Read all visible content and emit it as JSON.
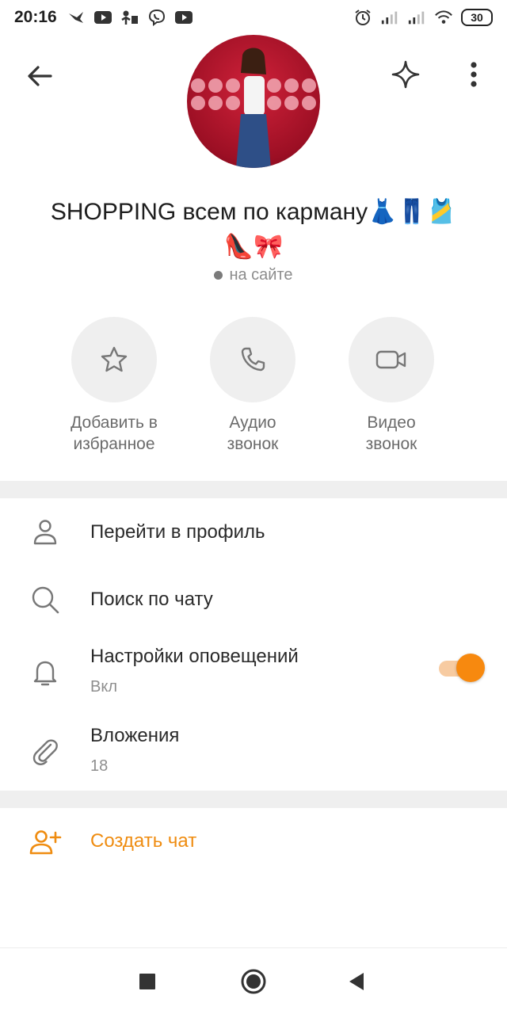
{
  "status_bar": {
    "time": "20:16",
    "battery": "30"
  },
  "header": {
    "back_icon": "arrow-left-icon",
    "sparkle_icon": "sparkle-icon",
    "more_icon": "more-vertical-icon"
  },
  "chat": {
    "title_line1": "SHOPPING всем по карману👗👖🎽",
    "title_line2": "👠🎀",
    "presence": "на сайте"
  },
  "actions": [
    {
      "icon": "star-icon",
      "line1": "Добавить в",
      "line2": "избранное"
    },
    {
      "icon": "phone-icon",
      "line1": "Аудио",
      "line2": "звонок"
    },
    {
      "icon": "video-icon",
      "line1": "Видео",
      "line2": "звонок"
    }
  ],
  "menu": {
    "profile": {
      "label": "Перейти в профиль",
      "icon": "person-icon"
    },
    "search": {
      "label": "Поиск по чату",
      "icon": "search-icon"
    },
    "notifications": {
      "label": "Настройки оповещений",
      "value": "Вкл",
      "icon": "bell-icon",
      "enabled": true
    },
    "attachments": {
      "label": "Вложения",
      "value": "18",
      "icon": "paperclip-icon"
    },
    "create_chat": {
      "label": "Создать чат",
      "icon": "add-person-icon"
    }
  },
  "colors": {
    "accent": "#f7890f",
    "muted_text": "#8e8e8e",
    "divider": "#efefef"
  }
}
